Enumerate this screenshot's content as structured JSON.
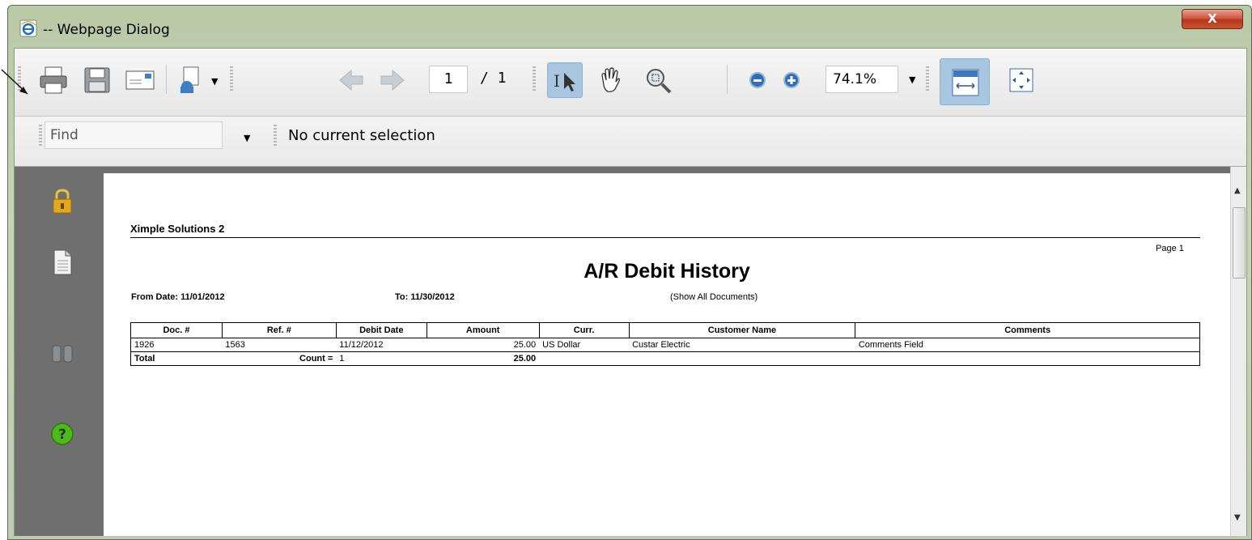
{
  "window": {
    "title": "-- Webpage Dialog",
    "close_label": "X"
  },
  "toolbar": {
    "page_current": "1",
    "page_total": "/ 1",
    "zoom": "74.1%",
    "icons": [
      "print-icon",
      "save-icon",
      "email-icon",
      "export-icon",
      "prev-page-icon",
      "next-page-icon",
      "select-text-icon",
      "hand-tool-icon",
      "marquee-zoom-icon",
      "zoom-out-icon",
      "zoom-in-icon",
      "fit-width-icon",
      "fit-page-icon"
    ]
  },
  "findbar": {
    "placeholder": "Find",
    "status": "No current selection"
  },
  "sidebar": {
    "icons": [
      "lock-icon",
      "page-icon",
      "binoculars-icon",
      "help-icon"
    ]
  },
  "report": {
    "company": "Ximple Solutions 2",
    "page": "Page 1",
    "title": "A/R Debit History",
    "from_date": "From Date: 11/01/2012",
    "to_date": "To: 11/30/2012",
    "filter": "(Show All Documents)",
    "columns": [
      "Doc. #",
      "Ref. #",
      "Debit Date",
      "Amount",
      "Curr.",
      "Customer Name",
      "Comments"
    ],
    "rows": [
      {
        "doc": "1926",
        "ref": "1563",
        "date": "11/12/2012",
        "amount": "25.00",
        "curr": "US Dollar",
        "customer": "Custar Electric",
        "comments": "Comments Field"
      }
    ],
    "total": {
      "label": "Total",
      "count_label": "Count =",
      "count": "1",
      "amount": "25.00"
    }
  },
  "colors": {
    "viewer_bg": "#6f6f6f",
    "active_tool": "#a9c6e0",
    "close_button": "#c9452c"
  }
}
